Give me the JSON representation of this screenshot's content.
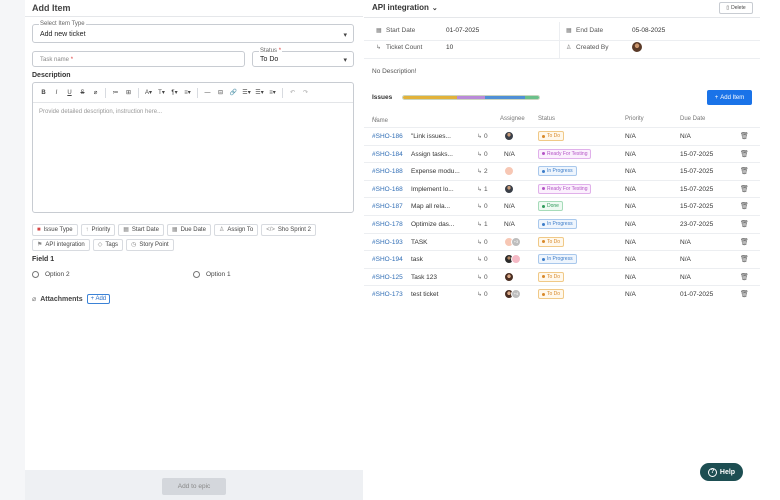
{
  "left": {
    "title": "Add Item",
    "select_item_type": {
      "label": "Select Item Type",
      "value": "Add new ticket"
    },
    "task_name": {
      "placeholder": "Task name"
    },
    "status": {
      "label": "Status",
      "value": "To Do"
    },
    "description": {
      "label": "Description",
      "placeholder": "Provide detailed description, instruction here..."
    },
    "toolbar": [
      "B",
      "I",
      "U",
      "S",
      "⌀",
      "≔",
      "⊞",
      "A",
      "T",
      "¶",
      "≡",
      "—",
      "⊟",
      "🔗",
      "☰",
      "☰",
      "≡",
      "↶",
      "↷"
    ],
    "chips": [
      {
        "icon": "issue-type-icon",
        "label": "Issue Type"
      },
      {
        "icon": "priority-icon",
        "label": "Priority"
      },
      {
        "icon": "calendar-icon",
        "label": "Start Date"
      },
      {
        "icon": "calendar-icon",
        "label": "Due Date"
      },
      {
        "icon": "user-icon",
        "label": "Assign To"
      },
      {
        "icon": "code-icon",
        "label": "Sho Sprint 2"
      },
      {
        "icon": "flag-icon",
        "label": "API integration"
      },
      {
        "icon": "tag-icon",
        "label": "Tags"
      },
      {
        "icon": "clock-icon",
        "label": "Story Point"
      }
    ],
    "field1": {
      "label": "Field 1",
      "options": [
        "Option 2",
        "Option 1"
      ]
    },
    "attachments": {
      "label": "Attachments",
      "add": "Add"
    },
    "add_to_epic": "Add to epic"
  },
  "right": {
    "title": "API integration",
    "delete": "Delete",
    "meta": {
      "start_date_label": "Start Date",
      "start_date": "01-07-2025",
      "end_date_label": "End Date",
      "end_date": "05-08-2025",
      "ticket_count_label": "Ticket Count",
      "ticket_count": "10",
      "created_by_label": "Created By"
    },
    "no_description": "No Description!",
    "issues_label": "Issues",
    "progress": [
      {
        "color": "#e2b23a",
        "fraction": 0.4
      },
      {
        "color": "#b98ad8",
        "fraction": 0.2
      },
      {
        "color": "#4f8fd6",
        "fraction": 0.3
      },
      {
        "color": "#6bc08a",
        "fraction": 0.1
      }
    ],
    "add_item": "Add Item",
    "columns": {
      "name": "Name",
      "assignee": "Assignee",
      "status": "Status",
      "priority": "Priority",
      "due": "Due Date"
    },
    "rows": [
      {
        "id": "#SHO-186",
        "title": "\"Link issues...",
        "sub": "0",
        "assignee": "man",
        "status": "To Do",
        "status_kind": "todo",
        "priority": "N/A",
        "due": "N/A"
      },
      {
        "id": "#SHO-184",
        "title": "Assign tasks...",
        "sub": "0",
        "assignee": "na",
        "status": "Ready For Testing",
        "status_kind": "ready",
        "priority": "N/A",
        "due": "15-07-2025"
      },
      {
        "id": "#SHO-188",
        "title": "Expense modu...",
        "sub": "2",
        "assignee": "peach",
        "status": "In Progress",
        "status_kind": "progress",
        "priority": "N/A",
        "due": "15-07-2025"
      },
      {
        "id": "#SHO-168",
        "title": "Implement lo...",
        "sub": "1",
        "assignee": "man",
        "status": "Ready For Testing",
        "status_kind": "ready",
        "priority": "N/A",
        "due": "15-07-2025"
      },
      {
        "id": "#SHO-187",
        "title": "Map all rela...",
        "sub": "0",
        "assignee": "na",
        "status": "Done",
        "status_kind": "done",
        "priority": "N/A",
        "due": "15-07-2025"
      },
      {
        "id": "#SHO-178",
        "title": "Optimize das...",
        "sub": "1",
        "assignee": "na",
        "status": "In Progress",
        "status_kind": "progress",
        "priority": "N/A",
        "due": "23-07-2025"
      },
      {
        "id": "#SHO-193",
        "title": "TASK",
        "sub": "0",
        "assignee": "peach+3",
        "status": "To Do",
        "status_kind": "todo",
        "priority": "N/A",
        "due": "N/A"
      },
      {
        "id": "#SHO-194",
        "title": "task",
        "sub": "0",
        "assignee": "dark+pink",
        "status": "In Progress",
        "status_kind": "progress",
        "priority": "N/A",
        "due": "N/A"
      },
      {
        "id": "#SHO-125",
        "title": "Task 123",
        "sub": "0",
        "assignee": "woman",
        "status": "To Do",
        "status_kind": "todo",
        "priority": "N/A",
        "due": "N/A"
      },
      {
        "id": "#SHO-173",
        "title": "test ticket",
        "sub": "0",
        "assignee": "woman+4",
        "status": "To Do",
        "status_kind": "todo",
        "priority": "N/A",
        "due": "01-07-2025"
      }
    ]
  },
  "help": "Help",
  "colors": {
    "todo": "#e8a33a",
    "ready": "#c76ad6",
    "progress": "#4f8fd6",
    "done": "#3fae6a",
    "accent": "#1a73e8"
  }
}
